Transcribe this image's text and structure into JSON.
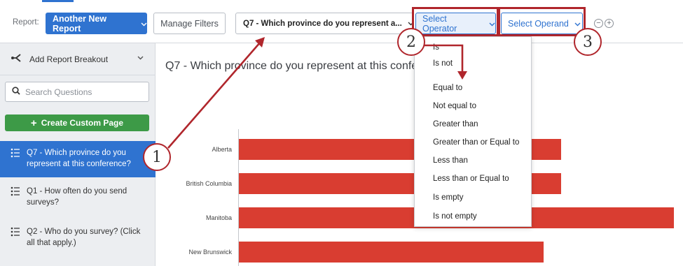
{
  "topbar": {
    "report_label": "Report:",
    "report_button": "Another New Report",
    "manage_filters": "Manage Filters",
    "question_select": "Q7 - Which province do you represent a...",
    "operator_select": "Select Operator",
    "operand_select": "Select Operand",
    "remove_symbol": "−",
    "add_symbol": "+"
  },
  "sidebar": {
    "breakout_label": "Add Report Breakout",
    "search_placeholder": "Search Questions",
    "create_button": "Create Custom Page",
    "create_plus": "+",
    "questions": [
      {
        "line1": "Q7 - Which province do you",
        "line2": "represent at this conference?"
      },
      {
        "line1": "Q1 - How often do you send",
        "line2": "surveys?"
      },
      {
        "line1": "Q2 - Who do you survey? (Click",
        "line2": "all that apply.)"
      }
    ]
  },
  "main": {
    "title": "Q7 - Which province do you represent at this conference?"
  },
  "chart_data": {
    "type": "bar",
    "orientation": "horizontal",
    "categories": [
      "Alberta",
      "British Columbia",
      "Manitoba",
      "New Brunswick"
    ],
    "values": [
      74,
      74,
      100,
      70
    ],
    "series_color": "#d93d31"
  },
  "operator_menu": {
    "items": [
      "Is",
      "Is not",
      "Equal to",
      "Not equal to",
      "Greater than",
      "Greater than or Equal to",
      "Less than",
      "Less than or Equal to",
      "Is empty",
      "Is not empty"
    ]
  },
  "callouts": [
    "1",
    "2",
    "3"
  ],
  "colors": {
    "accent": "#2f73d0",
    "create_green": "#3d9a47",
    "annotation_red": "#b0262c"
  }
}
